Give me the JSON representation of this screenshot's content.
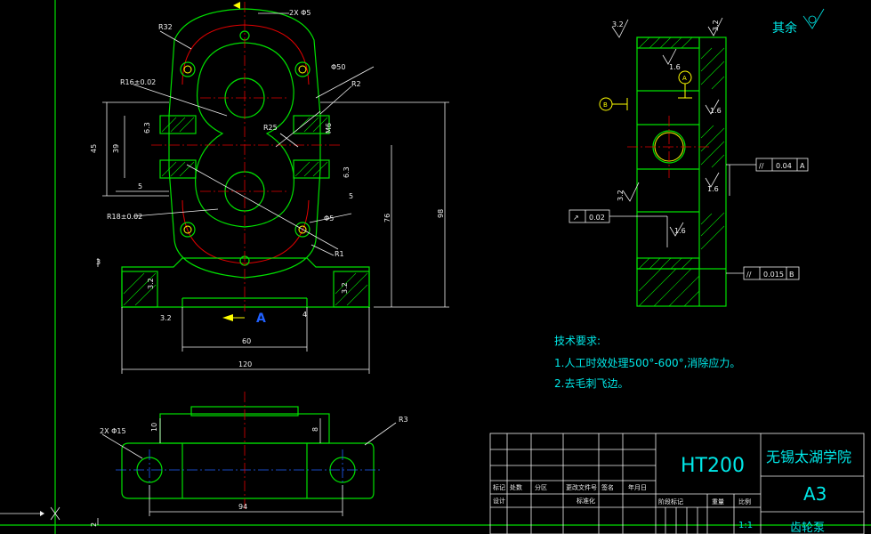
{
  "tech_req": {
    "title": "技术要求:",
    "line1": "1.人工时效处理500°-600°,消除应力。",
    "line2": "2.去毛刺飞边。"
  },
  "other_roughness": "其余",
  "title_block": {
    "material": "HT200",
    "school": "无锡太湖学院",
    "size": "A3",
    "scale": "1:1",
    "part_name": "齿轮泵",
    "row_labels": [
      "标记",
      "处数",
      "分区",
      "更改文件号",
      "签名",
      "年月日"
    ],
    "row2_labels": [
      "设计",
      "标准化"
    ],
    "stage_label": "阶段标记",
    "weight_label": "重量",
    "scale_label": "比例"
  },
  "front_view": {
    "holes_note": "2X Φ5",
    "radius_top": "R32",
    "hole_note2": "Φ50",
    "tol_note": "R16±0.02",
    "r2": "R2",
    "r25": "R25",
    "r18": "R18±0.02",
    "r6": "Φ5",
    "r1": "R1",
    "dim_45": "45",
    "dim_39": "39",
    "dim_5a": "5",
    "dim_5b": "5",
    "dim_3": "3",
    "dim_76": "76",
    "dim_98": "98",
    "dim_60": "60",
    "dim_4": "4",
    "dim_120": "120",
    "rough_32": "3.2",
    "rough_63": "6.3",
    "section_label": "A",
    "dim_m6": "M6"
  },
  "bottom_view": {
    "holes_note": "2X Φ15",
    "dim_10": "10",
    "dim_8": "8",
    "r3": "R3",
    "dim_94": "94",
    "dim_2": "2"
  },
  "side_view": {
    "rough_32": "3.2",
    "rough_16": "1.6",
    "datum_a": "A",
    "datum_b": "B",
    "tol1_sym": "//",
    "tol1_val": "0.04",
    "tol1_ref": "A",
    "tol2_sym": "↗",
    "tol2_val": "0.02",
    "tol3_sym": "//",
    "tol3_val": "0.015",
    "tol3_ref": "B"
  },
  "colors": {
    "outline": "#00e000",
    "center": "#e00000",
    "dimension": "#f0f0f0",
    "text": "#00e8e8",
    "datum": "#ffff00"
  }
}
